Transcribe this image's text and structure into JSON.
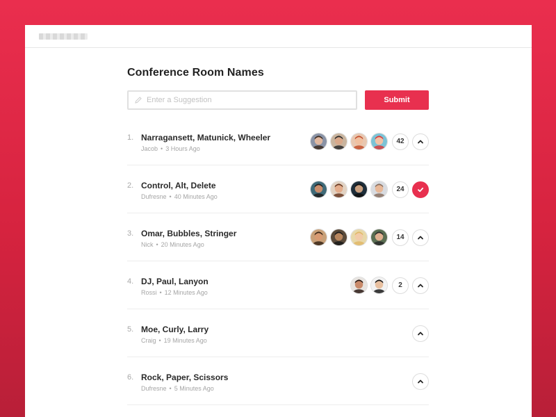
{
  "page": {
    "title": "Conference Room Names",
    "input_placeholder": "Enter a Suggestion",
    "submit_label": "Submit",
    "accent_color": "#e8304f"
  },
  "suggestions": [
    {
      "number": "1.",
      "name": "Narragansett, Matunick, Wheeler",
      "author": "Jacob",
      "time": "3 Hours Ago",
      "voters": [
        {
          "bg": "#8a93a6",
          "skin": "#e0b8a0",
          "hair": "#3a2a20"
        },
        {
          "bg": "#c9b49e",
          "skin": "#d9a88a",
          "hair": "#2b2b2b"
        },
        {
          "bg": "#e8c7b0",
          "skin": "#f0c0a0",
          "hair": "#c4502e"
        },
        {
          "bg": "#7cc3d6",
          "skin": "#f2c2a6",
          "hair": "#d93b3b"
        }
      ],
      "count": "42",
      "voted": false,
      "vote_icon": "chevron-up-icon"
    },
    {
      "number": "2.",
      "name": "Control, Alt, Delete",
      "author": "Dufresne",
      "time": "40 Minutes Ago",
      "voters": [
        {
          "bg": "#3f6a78",
          "skin": "#c98d6c",
          "hair": "#1f1f1f"
        },
        {
          "bg": "#e2d2c2",
          "skin": "#e4ad8c",
          "hair": "#6a3a22"
        },
        {
          "bg": "#1e2e3a",
          "skin": "#c9a080",
          "hair": "#111111"
        },
        {
          "bg": "#d8dbe0",
          "skin": "#e8b898",
          "hair": "#8a7060"
        }
      ],
      "count": "24",
      "voted": true,
      "vote_icon": "checkmark-icon"
    },
    {
      "number": "3.",
      "name": "Omar, Bubbles, Stringer",
      "author": "Nick",
      "time": "20 Minutes Ago",
      "voters": [
        {
          "bg": "#c8a078",
          "skin": "#d89a72",
          "hair": "#3a2718"
        },
        {
          "bg": "#5a4a3a",
          "skin": "#b8865e",
          "hair": "#1a1a1a"
        },
        {
          "bg": "#e8d8a8",
          "skin": "#f2cba8",
          "hair": "#e0b868"
        },
        {
          "bg": "#5a6e52",
          "skin": "#e0b090",
          "hair": "#2a2a2a"
        }
      ],
      "count": "14",
      "voted": false,
      "vote_icon": "chevron-up-icon"
    },
    {
      "number": "4.",
      "name": "DJ, Paul, Lanyon",
      "author": "Rossi",
      "time": "12 Minutes Ago",
      "voters": [
        {
          "bg": "#e8e4e0",
          "skin": "#c98a6a",
          "hair": "#2a1a14"
        },
        {
          "bg": "#f2f2f2",
          "skin": "#e8c0a0",
          "hair": "#1a1a1a"
        }
      ],
      "count": "2",
      "voted": false,
      "vote_icon": "chevron-up-icon"
    },
    {
      "number": "5.",
      "name": "Moe, Curly, Larry",
      "author": "Craig",
      "time": "19 Minutes Ago",
      "voters": [],
      "count": "",
      "voted": false,
      "vote_icon": "chevron-up-icon"
    },
    {
      "number": "6.",
      "name": "Rock, Paper, Scissors",
      "author": "Dufresne",
      "time": "5 Minutes Ago",
      "voters": [],
      "count": "",
      "voted": false,
      "vote_icon": "chevron-up-icon"
    }
  ]
}
